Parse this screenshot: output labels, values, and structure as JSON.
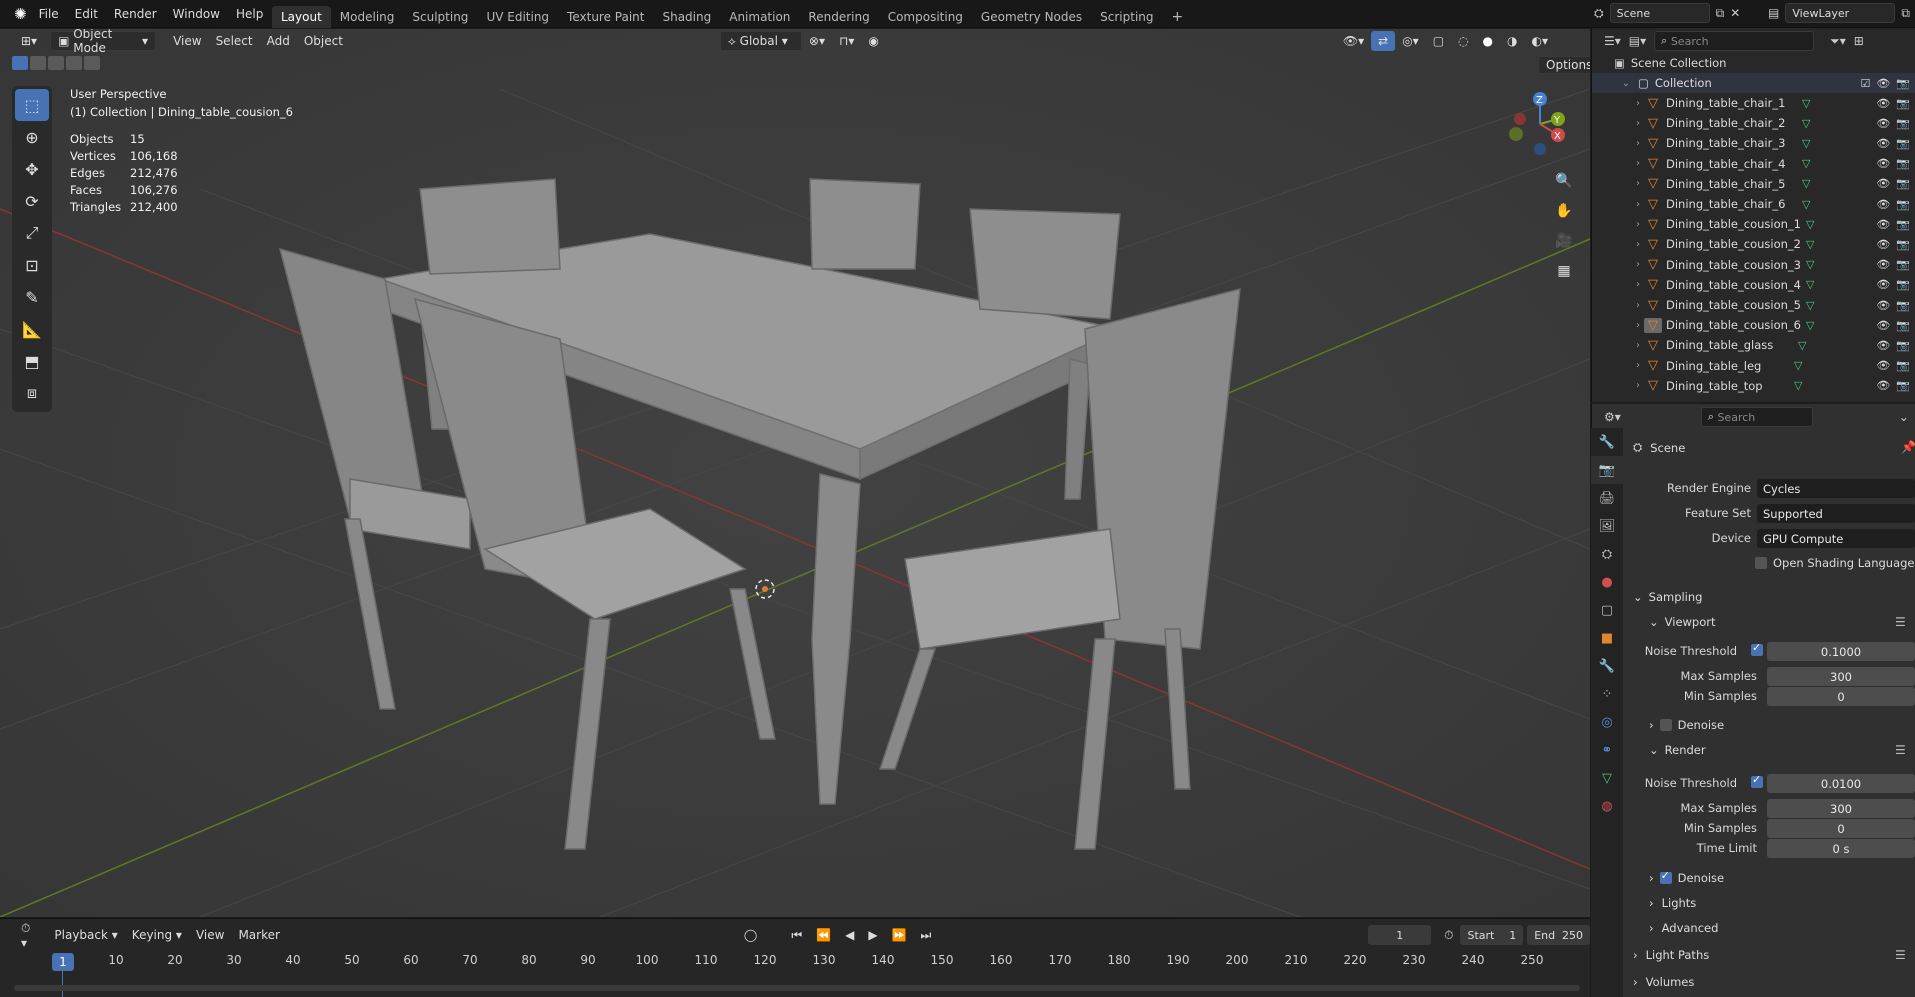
{
  "menu": [
    "File",
    "Edit",
    "Render",
    "Window",
    "Help"
  ],
  "workspaces": [
    "Layout",
    "Modeling",
    "Sculpting",
    "UV Editing",
    "Texture Paint",
    "Shading",
    "Animation",
    "Rendering",
    "Compositing",
    "Geometry Nodes",
    "Scripting"
  ],
  "scene_name": "Scene",
  "view_layer": "ViewLayer",
  "header": {
    "mode": "Object Mode",
    "view": "View",
    "select": "Select",
    "add": "Add",
    "object": "Object",
    "orientation": "Global",
    "options": "Options"
  },
  "overlay_text": {
    "perspective": "User Perspective",
    "collection": "(1) Collection | Dining_table_cousion_6",
    "stats": [
      {
        "k": "Objects",
        "v": "15"
      },
      {
        "k": "Vertices",
        "v": "106,168"
      },
      {
        "k": "Edges",
        "v": "212,476"
      },
      {
        "k": "Faces",
        "v": "106,276"
      },
      {
        "k": "Triangles",
        "v": "212,400"
      }
    ]
  },
  "outliner": {
    "search_placeholder": "Search",
    "root": "Scene Collection",
    "collection": "Collection",
    "items": [
      "Dining_table_chair_1",
      "Dining_table_chair_2",
      "Dining_table_chair_3",
      "Dining_table_chair_4",
      "Dining_table_chair_5",
      "Dining_table_chair_6",
      "Dining_table_cousion_1",
      "Dining_table_cousion_2",
      "Dining_table_cousion_3",
      "Dining_table_cousion_4",
      "Dining_table_cousion_5",
      "Dining_table_cousion_6",
      "Dining_table_glass",
      "Dining_table_leg",
      "Dining_table_top"
    ]
  },
  "properties": {
    "search_placeholder": "Search",
    "context": "Scene",
    "render_engine_label": "Render Engine",
    "render_engine": "Cycles",
    "feature_set_label": "Feature Set",
    "feature_set": "Supported",
    "device_label": "Device",
    "device": "GPU Compute",
    "osl_label": "Open Shading Language",
    "sampling": "Sampling",
    "viewport": "Viewport",
    "vp_noise_label": "Noise Threshold",
    "vp_noise": "0.1000",
    "vp_max_label": "Max Samples",
    "vp_max": "300",
    "vp_min_label": "Min Samples",
    "vp_min": "0",
    "denoise": "Denoise",
    "render": "Render",
    "r_noise_label": "Noise Threshold",
    "r_noise": "0.0100",
    "r_max_label": "Max Samples",
    "r_max": "300",
    "r_min_label": "Min Samples",
    "r_min": "0",
    "time_limit_label": "Time Limit",
    "time_limit": "0 s",
    "r_denoise": "Denoise",
    "lights": "Lights",
    "advanced": "Advanced",
    "light_paths": "Light Paths",
    "volumes": "Volumes"
  },
  "timeline": {
    "playback": "Playback",
    "keying": "Keying",
    "view": "View",
    "marker": "Marker",
    "current_frame": "1",
    "start_label": "Start",
    "start": "1",
    "end_label": "End",
    "end": "250",
    "ticks": [
      "1",
      "10",
      "20",
      "30",
      "40",
      "50",
      "60",
      "70",
      "80",
      "90",
      "100",
      "110",
      "120",
      "130",
      "140",
      "150",
      "160",
      "170",
      "180",
      "190",
      "200",
      "210",
      "220",
      "230",
      "240",
      "250"
    ]
  },
  "colors": {
    "accent": "#4772b3",
    "mesh_orange": "#e0862e",
    "green": "#4fc87f",
    "x_axis": "#b2413f",
    "y_axis": "#6b8f1f"
  }
}
